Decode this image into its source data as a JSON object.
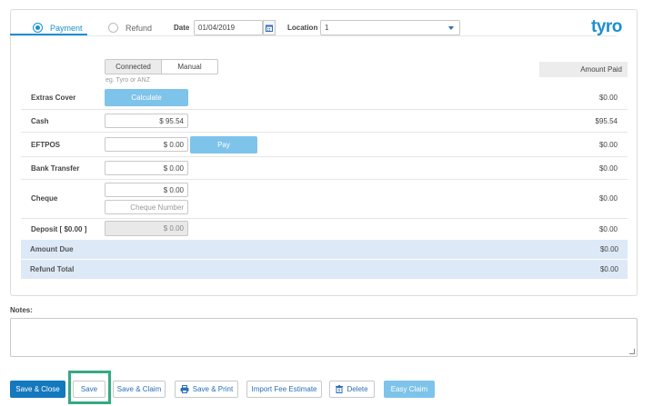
{
  "header": {
    "payment_label": "Payment",
    "refund_label": "Refund",
    "date_label": "Date",
    "date_value": "01/04/2019",
    "location_label": "Location",
    "location_value": "1",
    "logo_text": "tyro"
  },
  "terminal": {
    "connected_label": "Connected",
    "manual_label": "Manual",
    "hint": "eg. Tyro or ANZ",
    "amount_paid_label": "Amount Paid"
  },
  "rows": {
    "extras_cover": {
      "label": "Extras Cover",
      "button": "Calculate",
      "amount": "$0.00"
    },
    "cash": {
      "label": "Cash",
      "value": "$ 95.54",
      "amount": "$95.54"
    },
    "eftpos": {
      "label": "EFTPOS",
      "value": "$ 0.00",
      "button": "Pay",
      "amount": "$0.00"
    },
    "bank_transfer": {
      "label": "Bank Transfer",
      "value": "$ 0.00",
      "amount": "$0.00"
    },
    "cheque": {
      "label": "Cheque",
      "value": "$ 0.00",
      "number_placeholder": "Cheque Number",
      "amount": "$0.00"
    },
    "deposit": {
      "label": "Deposit  [ $0.00 ]",
      "value": "$ 0.00",
      "amount": "$0.00"
    }
  },
  "totals": {
    "amount_due_label": "Amount Due",
    "amount_due_value": "$0.00",
    "refund_total_label": "Refund Total",
    "refund_total_value": "$0.00"
  },
  "notes": {
    "label": "Notes:",
    "value": ""
  },
  "actions": {
    "save_close": "Save & Close",
    "save": "Save",
    "save_claim": "Save & Claim",
    "save_print": "Save & Print",
    "import_fee": "Import Fee Estimate",
    "delete": "Delete",
    "easy_claim": "Easy Claim"
  },
  "colors": {
    "accent": "#1a8fd1",
    "primary_button": "#1478be",
    "light_button": "#7ec3ea",
    "band": "#dde9f7",
    "highlight": "#35a983"
  }
}
